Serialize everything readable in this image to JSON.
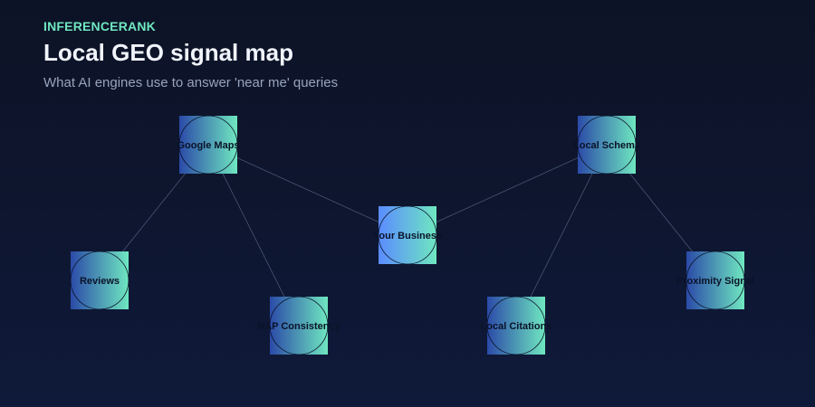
{
  "header": {
    "brand": "INFERENCERANK",
    "title": "Local GEO signal map",
    "subtitle": "What AI engines use to answer 'near me' queries"
  },
  "colors": {
    "background": "#0e1630",
    "brand": "#6fe7c0",
    "node_gradient_start": "#2b4aa8",
    "node_gradient_end": "#6fe7c0",
    "center_gradient_start": "#5a8cff",
    "center_gradient_end": "#6fe7c0",
    "edge": "#51617f"
  },
  "diagram": {
    "nodes": [
      {
        "id": "business",
        "label": "Your Business",
        "role": "center"
      },
      {
        "id": "maps",
        "label": "Google Maps",
        "role": "primary"
      },
      {
        "id": "schema",
        "label": "Local Schema",
        "role": "primary"
      },
      {
        "id": "reviews",
        "label": "Reviews",
        "role": "secondary"
      },
      {
        "id": "nap",
        "label": "NAP Consistency",
        "role": "secondary"
      },
      {
        "id": "citations",
        "label": "Local Citations",
        "role": "secondary"
      },
      {
        "id": "proximity",
        "label": "Proximity Signal",
        "role": "secondary"
      }
    ],
    "edges": [
      {
        "from": "maps",
        "to": "business"
      },
      {
        "from": "schema",
        "to": "business"
      },
      {
        "from": "maps",
        "to": "reviews"
      },
      {
        "from": "maps",
        "to": "nap"
      },
      {
        "from": "schema",
        "to": "citations"
      },
      {
        "from": "schema",
        "to": "proximity"
      }
    ]
  }
}
